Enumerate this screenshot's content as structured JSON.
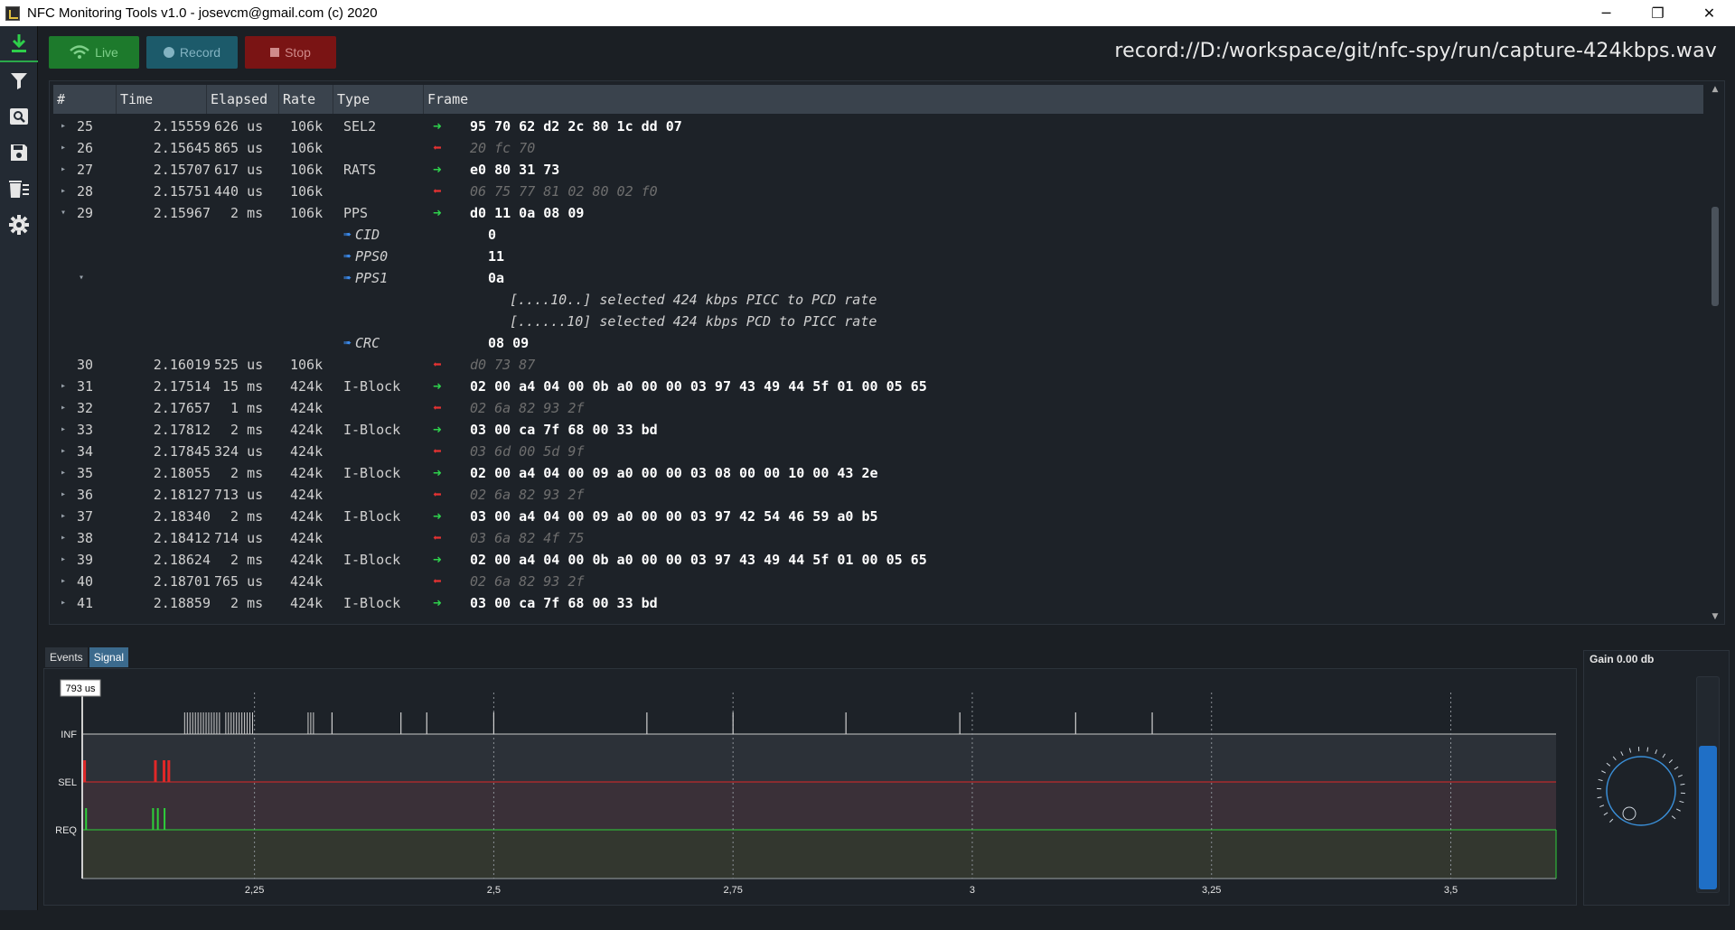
{
  "window": {
    "title": "NFC Monitoring Tools v1.0 - josevcm@gmail.com (c) 2020",
    "minimize": "─",
    "maximize": "❐",
    "close": "✕"
  },
  "sidebar": [
    {
      "name": "download-icon",
      "active": true
    },
    {
      "name": "filter-icon"
    },
    {
      "name": "search-icon"
    },
    {
      "name": "save-icon"
    },
    {
      "name": "clear-list-icon"
    },
    {
      "name": "gear-icon"
    }
  ],
  "toolbar": {
    "live_label": "Live",
    "record_label": "Record",
    "stop_label": "Stop"
  },
  "source_path": "record://D:/workspace/git/nfc-spy/run/capture-424kbps.wav",
  "table": {
    "headers": [
      "#",
      "Time",
      "Elapsed",
      "Rate",
      "Type",
      "Frame"
    ],
    "rows": [
      {
        "exp": "▸",
        "num": "25",
        "time": "2.15559",
        "elapsed": "626 us",
        "rate": "106k",
        "type": "SEL2",
        "dir": "out",
        "frame": "95 70 62 d2 2c 80 1c dd 07"
      },
      {
        "exp": "▸",
        "num": "26",
        "time": "2.15645",
        "elapsed": "865 us",
        "rate": "106k",
        "type": "",
        "dir": "in",
        "frame": "20 fc 70"
      },
      {
        "exp": "▸",
        "num": "27",
        "time": "2.15707",
        "elapsed": "617 us",
        "rate": "106k",
        "type": "RATS",
        "dir": "out",
        "frame": "e0 80 31 73"
      },
      {
        "exp": "▸",
        "num": "28",
        "time": "2.15751",
        "elapsed": "440 us",
        "rate": "106k",
        "type": "",
        "dir": "in",
        "frame": "06 75 77 81 02 80 02 f0"
      },
      {
        "exp": "▾",
        "num": "29",
        "time": "2.15967",
        "elapsed": "  2 ms",
        "rate": "106k",
        "type": "PPS",
        "dir": "out",
        "frame": "d0 11 0a 08 09"
      },
      {
        "sub": true,
        "field": "CID",
        "value": "0"
      },
      {
        "sub": true,
        "field": "PPS0",
        "value": "11"
      },
      {
        "sub": true,
        "field": "PPS1",
        "value": "0a",
        "exp": "▾"
      },
      {
        "sub": true,
        "desc": "[....10..] selected 424 kbps PICC to PCD rate"
      },
      {
        "sub": true,
        "desc": "[......10] selected 424 kbps PCD to PICC rate"
      },
      {
        "sub": true,
        "field": "CRC",
        "value": "08 09"
      },
      {
        "exp": "",
        "num": "30",
        "time": "2.16019",
        "elapsed": "525 us",
        "rate": "106k",
        "type": "",
        "dir": "in",
        "frame": "d0 73 87"
      },
      {
        "exp": "▸",
        "num": "31",
        "time": "2.17514",
        "elapsed": " 15 ms",
        "rate": "424k",
        "type": "I-Block",
        "dir": "out",
        "frame": "02 00 a4 04 00 0b a0 00 00 03 97 43 49 44 5f 01 00 05 65"
      },
      {
        "exp": "▸",
        "num": "32",
        "time": "2.17657",
        "elapsed": "  1 ms",
        "rate": "424k",
        "type": "",
        "dir": "in",
        "frame": "02 6a 82 93 2f"
      },
      {
        "exp": "▸",
        "num": "33",
        "time": "2.17812",
        "elapsed": "  2 ms",
        "rate": "424k",
        "type": "I-Block",
        "dir": "out",
        "frame": "03 00 ca 7f 68 00 33 bd"
      },
      {
        "exp": "▸",
        "num": "34",
        "time": "2.17845",
        "elapsed": "324 us",
        "rate": "424k",
        "type": "",
        "dir": "in",
        "frame": "03 6d 00 5d 9f"
      },
      {
        "exp": "▸",
        "num": "35",
        "time": "2.18055",
        "elapsed": "  2 ms",
        "rate": "424k",
        "type": "I-Block",
        "dir": "out",
        "frame": "02 00 a4 04 00 09 a0 00 00 03 08 00 00 10 00 43 2e"
      },
      {
        "exp": "▸",
        "num": "36",
        "time": "2.18127",
        "elapsed": "713 us",
        "rate": "424k",
        "type": "",
        "dir": "in",
        "frame": "02 6a 82 93 2f"
      },
      {
        "exp": "▸",
        "num": "37",
        "time": "2.18340",
        "elapsed": "  2 ms",
        "rate": "424k",
        "type": "I-Block",
        "dir": "out",
        "frame": "03 00 a4 04 00 09 a0 00 00 03 97 42 54 46 59 a0 b5"
      },
      {
        "exp": "▸",
        "num": "38",
        "time": "2.18412",
        "elapsed": "714 us",
        "rate": "424k",
        "type": "",
        "dir": "in",
        "frame": "03 6a 82 4f 75"
      },
      {
        "exp": "▸",
        "num": "39",
        "time": "2.18624",
        "elapsed": "  2 ms",
        "rate": "424k",
        "type": "I-Block",
        "dir": "out",
        "frame": "02 00 a4 04 00 0b a0 00 00 03 97 43 49 44 5f 01 00 05 65"
      },
      {
        "exp": "▸",
        "num": "40",
        "time": "2.18701",
        "elapsed": "765 us",
        "rate": "424k",
        "type": "",
        "dir": "in",
        "frame": "02 6a 82 93 2f"
      },
      {
        "exp": "▸",
        "num": "41",
        "time": "2.18859",
        "elapsed": "  2 ms",
        "rate": "424k",
        "type": "I-Block",
        "dir": "out",
        "frame": "03 00 ca 7f 68 00 33 bd"
      }
    ]
  },
  "tabs": [
    {
      "label": "Events",
      "active": false
    },
    {
      "label": "Signal",
      "active": true
    }
  ],
  "signal": {
    "cursor_readout": "793 us",
    "lanes": [
      "INF",
      "SEL",
      "REQ"
    ],
    "x_ticks": [
      "2,25",
      "2,5",
      "2,75",
      "3",
      "3,25",
      "3,5"
    ],
    "x_tick_values": [
      2.25,
      2.5,
      2.75,
      3.0,
      3.25,
      3.5
    ],
    "x_range": [
      2.07,
      3.61
    ],
    "inf_marks": [
      2.331,
      2.403,
      2.43,
      2.5,
      2.66,
      2.75,
      2.868,
      2.987,
      3.108,
      3.188
    ],
    "inf_dense": [
      [
        2.177,
        2.215
      ],
      [
        2.22,
        2.25
      ],
      [
        2.306,
        2.312
      ]
    ],
    "sel_marks": [
      2.072,
      2.146,
      2.155,
      2.16
    ],
    "req_marks": [
      2.074,
      2.144,
      2.149,
      2.156
    ],
    "colors": {
      "inf": "#d0d0d0",
      "sel": "#e02828",
      "req": "#2ecf3a"
    }
  },
  "gain": {
    "label": "Gain  0.00 db",
    "level": 0.68
  }
}
